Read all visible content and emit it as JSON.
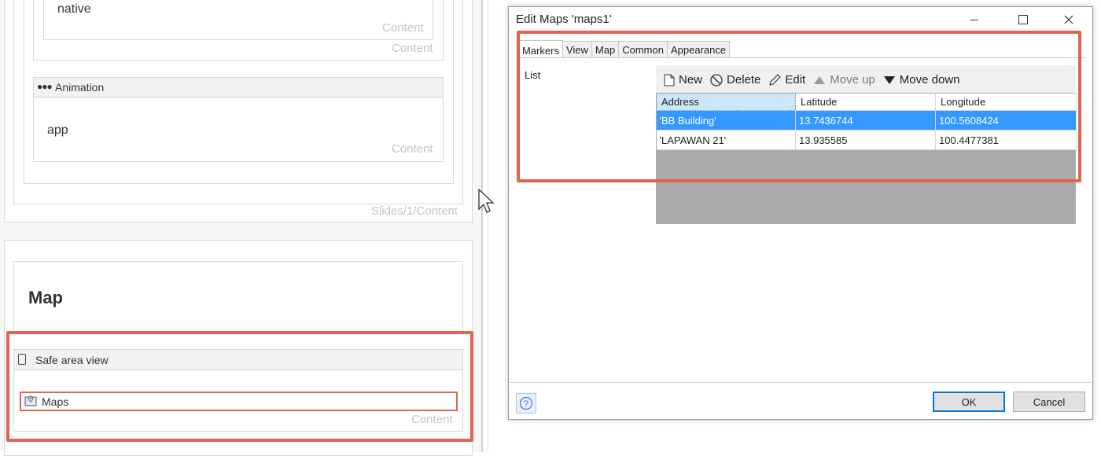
{
  "designer": {
    "native_text": "native",
    "content_label": "Content",
    "animation_header": "Animation",
    "app_text": "app",
    "slides_content_label": "Slides/1/Content",
    "map_title": "Map",
    "safe_area_header": "Safe area view",
    "maps_widget": "Maps"
  },
  "dialog": {
    "title": "Edit Maps 'maps1'",
    "tabs": [
      {
        "label": "Markers",
        "active": true
      },
      {
        "label": "View"
      },
      {
        "label": "Map"
      },
      {
        "label": "Common"
      },
      {
        "label": "Appearance"
      }
    ],
    "list_label": "List",
    "toolbar": {
      "new": "New",
      "delete": "Delete",
      "edit": "Edit",
      "move_up": "Move up",
      "move_down": "Move down"
    },
    "grid": {
      "columns": [
        "Address",
        "Latitude",
        "Longitude"
      ],
      "rows": [
        {
          "address": "'BB Building'",
          "latitude": "13.7436744",
          "longitude": "100.5608424",
          "selected": true
        },
        {
          "address": "'LAPAWAN 21'",
          "latitude": "13.935585",
          "longitude": "100.4477381",
          "selected": false
        }
      ]
    },
    "ok_label": "OK",
    "cancel_label": "Cancel"
  },
  "colors": {
    "highlight_frame": "#e06450",
    "selection": "#3399ff",
    "grid_empty": "#ababab"
  }
}
